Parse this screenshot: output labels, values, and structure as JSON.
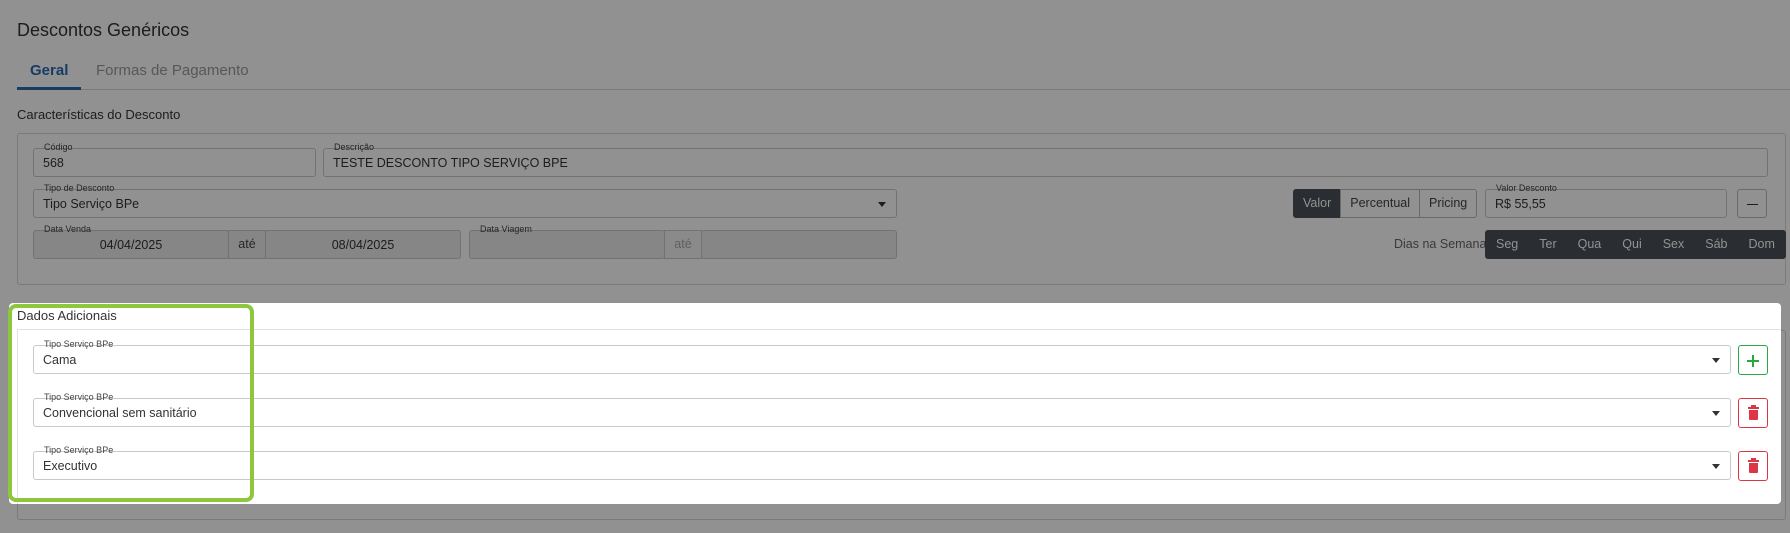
{
  "page": {
    "title": "Descontos Genéricos"
  },
  "tabs": [
    {
      "label": "Geral",
      "active": true
    },
    {
      "label": "Formas de Pagamento",
      "active": false
    }
  ],
  "caracteristicas": {
    "title": "Características do Desconto",
    "codigo": {
      "label": "Código",
      "value": "568"
    },
    "descricao": {
      "label": "Descrição",
      "value": "TESTE DESCONTO TIPO SERVIÇO BPE"
    },
    "tipo_desconto": {
      "label": "Tipo de Desconto",
      "value": "Tipo Serviço BPe"
    },
    "modo": {
      "options": [
        "Valor",
        "Percentual",
        "Pricing"
      ],
      "selected": "Valor"
    },
    "valor_desconto": {
      "label": "Valor Desconto",
      "value": "R$ 55,55"
    },
    "data_venda": {
      "label": "Data Venda",
      "from": "04/04/2025",
      "ate": "até",
      "to": "08/04/2025"
    },
    "data_viagem": {
      "label": "Data Viagem",
      "from": "",
      "ate": "até",
      "to": ""
    },
    "dias_semana": {
      "label": "Dias na Semana",
      "days": [
        "Seg",
        "Ter",
        "Qua",
        "Qui",
        "Sex",
        "Sáb",
        "Dom"
      ]
    }
  },
  "dados_adicionais": {
    "title": "Dados Adicionais",
    "rows": [
      {
        "label": "Tipo Serviço BPe",
        "value": "Cama",
        "action": "add"
      },
      {
        "label": "Tipo Serviço BPe",
        "value": "Convencional sem sanitário",
        "action": "delete"
      },
      {
        "label": "Tipo Serviço BPe",
        "value": "Executivo",
        "action": "delete"
      }
    ]
  },
  "colors": {
    "accent": "#2a6cb0",
    "active_button": "#4b4f56",
    "add": "#28a745",
    "delete": "#dc3545",
    "highlight_border": "#8dc63f"
  }
}
